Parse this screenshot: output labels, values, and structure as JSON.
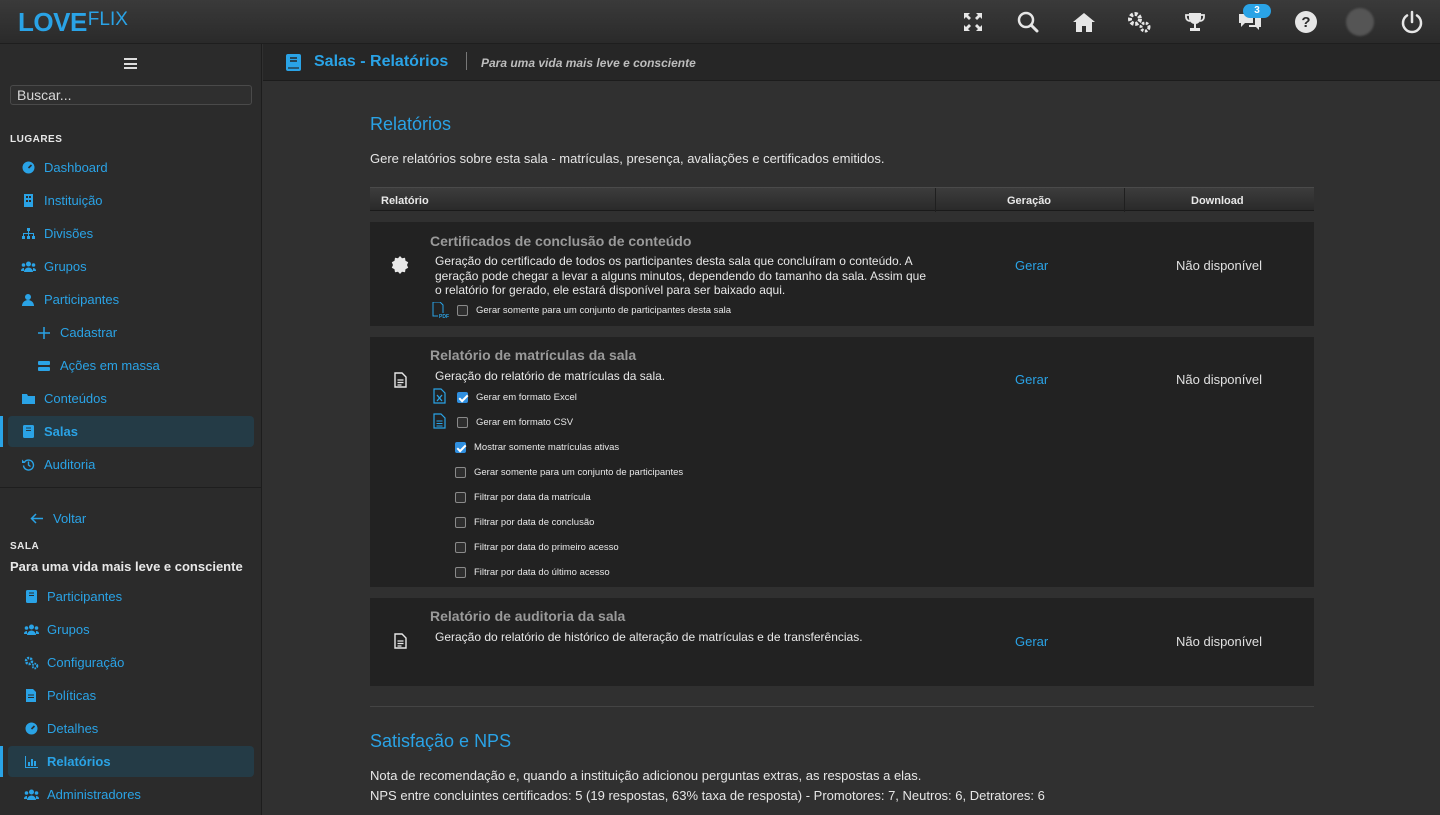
{
  "app": {
    "logo_main": "LOVE",
    "logo_sub": "FLIX",
    "brand_color": "#2aa3e6",
    "notifications_count": "3"
  },
  "topbar_icons": [
    "fullscreen-icon",
    "search-icon",
    "home-icon",
    "settings-icon",
    "trophy-icon",
    "chat-icon",
    "help-icon",
    "user-avatar",
    "power-icon"
  ],
  "sidebar": {
    "search_placeholder": "Buscar...",
    "section_places": "LUGARES",
    "places": [
      {
        "label": "Dashboard",
        "icon": "dashboard-icon"
      },
      {
        "label": "Instituição",
        "icon": "building-icon"
      },
      {
        "label": "Divisões",
        "icon": "sitemap-icon"
      },
      {
        "label": "Grupos",
        "icon": "users-icon"
      },
      {
        "label": "Participantes",
        "icon": "user-icon"
      },
      {
        "label": "Cadastrar",
        "icon": "plus-icon"
      },
      {
        "label": "Ações em massa",
        "icon": "server-icon"
      },
      {
        "label": "Conteúdos",
        "icon": "folder-icon"
      },
      {
        "label": "Salas",
        "icon": "book-icon"
      },
      {
        "label": "Auditoria",
        "icon": "history-icon"
      }
    ],
    "back_label": "Voltar",
    "section_room": "SALA",
    "room_name": "Para uma vida mais leve e consciente",
    "room_items": [
      {
        "label": "Participantes",
        "icon": "book-icon"
      },
      {
        "label": "Grupos",
        "icon": "users-icon"
      },
      {
        "label": "Configuração",
        "icon": "cogs-icon"
      },
      {
        "label": "Políticas",
        "icon": "file-icon"
      },
      {
        "label": "Detalhes",
        "icon": "dashboard-icon"
      },
      {
        "label": "Relatórios",
        "icon": "chart-icon"
      },
      {
        "label": "Administradores",
        "icon": "users-icon"
      }
    ]
  },
  "header": {
    "title": "Salas - Relatórios",
    "subtitle": "Para uma vida mais leve e consciente"
  },
  "reports": {
    "heading": "Relatórios",
    "description": "Gere relatórios sobre esta sala - matrículas, presença, avaliações e certificados emitidos.",
    "columns": [
      "Relatório",
      "Geração",
      "Download"
    ],
    "rows": [
      {
        "title": "Certificados de conclusão de conteúdo",
        "description": "Geração do certificado de todos os participantes desta sala que concluíram o conteúdo. A geração pode chegar a levar a alguns minutos, dependendo do tamanho da sala. Assim que o relatório for gerado, ele estará disponível para ser baixado aqui.",
        "action": "Gerar",
        "download": "Não disponível",
        "options": [
          {
            "label": "Gerar somente para um conjunto de participantes desta sala",
            "checked": false
          }
        ]
      },
      {
        "title": "Relatório de matrículas da sala",
        "description": "Geração do relatório de matrículas da sala.",
        "action": "Gerar",
        "download": "Não disponível",
        "options": [
          {
            "label": "Gerar em formato Excel",
            "checked": true
          },
          {
            "label": "Gerar em formato CSV",
            "checked": false
          },
          {
            "label": "Mostrar somente matrículas ativas",
            "checked": true
          },
          {
            "label": "Gerar somente para um conjunto de participantes",
            "checked": false
          },
          {
            "label": "Filtrar por data da matrícula",
            "checked": false
          },
          {
            "label": "Filtrar por data de conclusão",
            "checked": false
          },
          {
            "label": "Filtrar por data do primeiro acesso",
            "checked": false
          },
          {
            "label": "Filtrar por data do último acesso",
            "checked": false
          }
        ]
      },
      {
        "title": "Relatório de auditoria da sala",
        "description": "Geração do relatório de histórico de alteração de matrículas e de transferências.",
        "action": "Gerar",
        "download": "Não disponível",
        "options": []
      }
    ]
  },
  "nps": {
    "heading": "Satisfação e NPS",
    "line1": "Nota de recomendação e, quando a instituição adicionou perguntas extras, as respostas a elas.",
    "line2": "NPS entre concluintes certificados: 5 (19 respostas, 63% taxa de resposta) - Promotores: 7, Neutros: 6, Detratores: 6"
  }
}
